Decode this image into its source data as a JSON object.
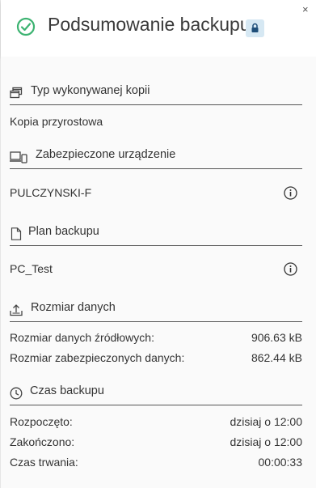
{
  "header": {
    "title": "Podsumowanie backupu",
    "close_symbol": "×",
    "check_icon": "check-circle-icon",
    "lock_icon": "lock-icon",
    "accent_color": "#3cb371"
  },
  "sections": {
    "backup_type": {
      "icon": "copies-icon",
      "heading": "Typ wykonywanej kopii",
      "value": "Kopia przyrostowa"
    },
    "device": {
      "icon": "device-icon",
      "heading": "Zabezpieczone urządzenie",
      "value": "PULCZYNSKI-F"
    },
    "plan": {
      "icon": "document-icon",
      "heading": "Plan backupu",
      "value": "PC_Test"
    },
    "data_size": {
      "icon": "upload-icon",
      "heading": "Rozmiar danych",
      "rows": [
        {
          "label": "Rozmiar danych źródłowych:",
          "value": "906.63 kB"
        },
        {
          "label": "Rozmiar zabezpieczonych danych:",
          "value": "862.44 kB"
        }
      ]
    },
    "time": {
      "icon": "clock-icon",
      "heading": "Czas backupu",
      "rows": [
        {
          "label": "Rozpoczęto:",
          "value": "dzisiaj o 12:00"
        },
        {
          "label": "Zakończono:",
          "value": "dzisiaj o 12:00"
        },
        {
          "label": "Czas trwania:",
          "value": "00:00:33"
        }
      ]
    }
  }
}
